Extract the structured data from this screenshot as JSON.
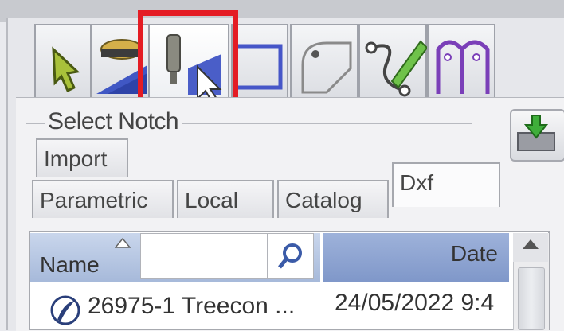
{
  "toolbar": {
    "tools": [
      {
        "name": "select-tool",
        "icon": "arrow-pointer-icon"
      },
      {
        "name": "profile-tool",
        "icon": "saw-profile-icon"
      },
      {
        "name": "notch-tool",
        "icon": "notch-cursor-icon",
        "active": true
      },
      {
        "name": "rectangle-tool",
        "icon": "rectangle-icon"
      },
      {
        "name": "corner-tool",
        "icon": "corner-shape-icon"
      },
      {
        "name": "curve-tool",
        "icon": "curve-pencil-icon"
      },
      {
        "name": "arch-tool",
        "icon": "arch-frame-icon"
      }
    ],
    "highlight_color": "#e41c24"
  },
  "panel": {
    "group_label": "Select Notch",
    "import_button_icon": "import-green-arrow-icon",
    "tabs_row1": [
      {
        "label": "Import"
      }
    ],
    "tabs_row2": [
      {
        "label": "Parametric"
      },
      {
        "label": "Local"
      },
      {
        "label": "Catalog"
      },
      {
        "label": "Dxf",
        "active": true
      }
    ]
  },
  "table": {
    "columns": {
      "name": "Name",
      "date": "Date"
    },
    "search": {
      "value": "",
      "icon": "search-icon"
    },
    "rows": [
      {
        "name": "26975-1 Treecon ...",
        "date": "24/05/2022 9:4",
        "icon": "dxf-file-icon"
      }
    ]
  }
}
